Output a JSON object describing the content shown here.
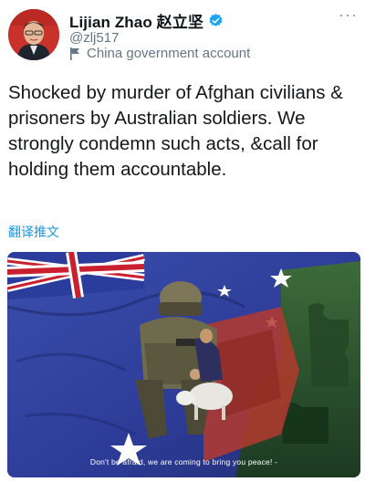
{
  "author": {
    "display_name": "Lijian Zhao 赵立坚",
    "handle": "@zlj517",
    "label": "China government account",
    "verified": true
  },
  "more_icon": "ellipsis-icon",
  "tweet": {
    "text": "Shocked by murder of Afghan civilians & prisoners by Australian soldiers. We strongly condemn such acts, &call for holding them accountable.",
    "translate_link": "翻译推文"
  },
  "media": {
    "caption": "Don't be afraid, we are coming to bring you peace! -"
  },
  "colors": {
    "accent": "#1da1f2",
    "muted": "#657786",
    "link": "#1b95e0"
  }
}
